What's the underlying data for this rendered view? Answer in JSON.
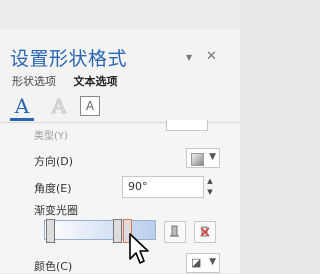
{
  "pane": {
    "title": "设置形状格式",
    "header_icons": {
      "dropdown": "chevron-down-icon",
      "close": "close-icon"
    },
    "tabs": [
      {
        "label": "形状选项",
        "active": false
      },
      {
        "label": "文本选项",
        "active": true
      }
    ]
  },
  "text_effects": [
    {
      "name": "text-fill-icon",
      "glyph": "A",
      "active": true
    },
    {
      "name": "text-outline-icon",
      "glyph": "A",
      "active": false
    },
    {
      "name": "text-box-icon",
      "glyph": "A",
      "active": false
    }
  ],
  "gradient_settings": {
    "clipped_row_label": "类型(Y)",
    "direction": {
      "label": "方向(D)"
    },
    "angle": {
      "label": "角度(E)",
      "value": "90°"
    },
    "gradient_stops": {
      "label": "渐变光圈",
      "stop_count": 3,
      "selected_stop": 2
    },
    "add_stop_icon": "add-gradient-stop-icon",
    "remove_stop_icon": "remove-gradient-stop-icon",
    "color": {
      "label": "颜色(C)",
      "icon": "paint-bucket-icon"
    }
  },
  "colors": {
    "accent": "#2a65b6",
    "selected_stop": "#e0794a"
  }
}
